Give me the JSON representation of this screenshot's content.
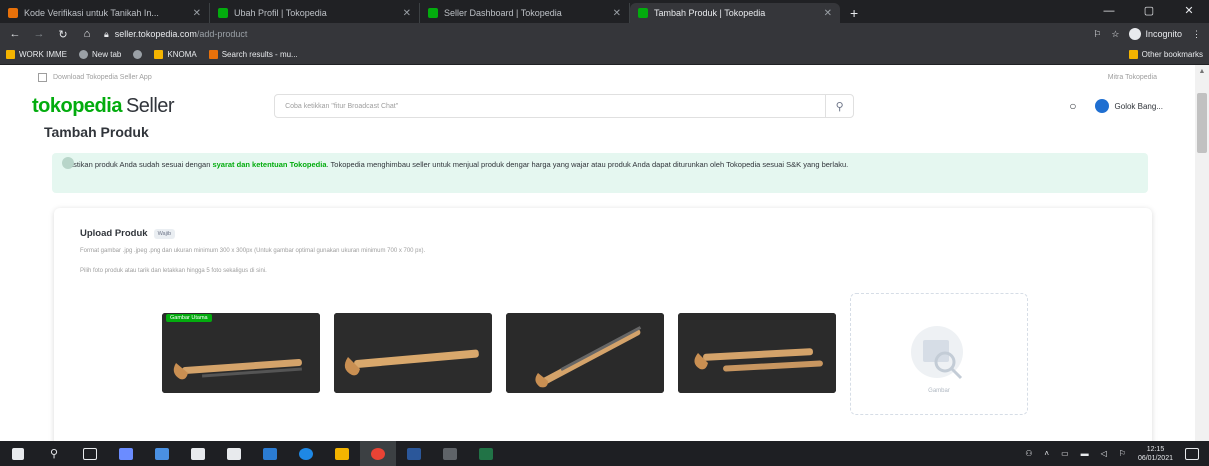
{
  "browser": {
    "tabs": [
      {
        "title": "Kode Verifikasi untuk Tanikah In...",
        "favicon_color": "#e8710a",
        "active": false
      },
      {
        "title": "Ubah Profil | Tokopedia",
        "favicon_color": "#03ac0e",
        "active": false
      },
      {
        "title": "Seller Dashboard | Tokopedia",
        "favicon_color": "#03ac0e",
        "active": false
      },
      {
        "title": "Tambah Produk | Tokopedia",
        "favicon_color": "#03ac0e",
        "active": true
      }
    ],
    "new_tab_label": "+",
    "window_controls": {
      "minimize": "—",
      "maximize": "▢",
      "close": "✕"
    },
    "url_host": "seller.tokopedia.com",
    "url_path": "/add-product",
    "profile_label": "Incognito",
    "bookmarks": [
      {
        "label": "WORK IMME",
        "color": "#f4b400"
      },
      {
        "label": "New tab",
        "color": "#9aa0a6"
      },
      {
        "label": "",
        "color": "#9aa0a6"
      },
      {
        "label": "KNOMA",
        "color": "#f4b400"
      },
      {
        "label": "Search results - mu...",
        "color": "#e8710a"
      }
    ],
    "other_bookmarks": "Other bookmarks"
  },
  "page": {
    "promo_text": "Download Tokopedia Seller App",
    "promo_right": "Mitra Tokopedia",
    "logo_main": "tokopedia",
    "logo_sub": "Seller",
    "search_placeholder": "Coba ketikkan \"fitur Broadcast Chat\"",
    "shop_name": "Golok Bang...",
    "title": "Tambah Produk",
    "notice_before": "Pastikan produk Anda sudah sesuai dengan ",
    "notice_link": "syarat dan ketentuan Tokopedia",
    "notice_after": ". Tokopedia menghimbau seller untuk menjual produk dengar harga yang wajar atau produk Anda dapat diturunkan oleh Tokopedia sesuai S&K yang berlaku.",
    "upload": {
      "title": "Upload Produk",
      "tag": "Wajib",
      "desc1": "Format gambar .jpg .jpeg .png dan ukuran minimum 300 x 300px (Untuk gambar optimal gunakan ukuran minimum 700 x 700 px).",
      "desc2": "Pilih foto produk atau tarik dan letakkan hingga 5 foto sekaligus di sini.",
      "main_badge": "Gambar Utama",
      "empty_slot_label": "Gambar"
    }
  },
  "taskbar": {
    "time": "12:15",
    "date": "06/01/2021",
    "apps": [
      "#2f3237",
      "#6b8cff",
      "#4a90e2",
      "#e8eaed",
      "#e8eaed",
      "#e8eaed",
      "#2b7cd3",
      "#1e88e5",
      "#f4b400",
      "#ea4335",
      "#2b579a",
      "#5f6368",
      "#217346"
    ]
  }
}
